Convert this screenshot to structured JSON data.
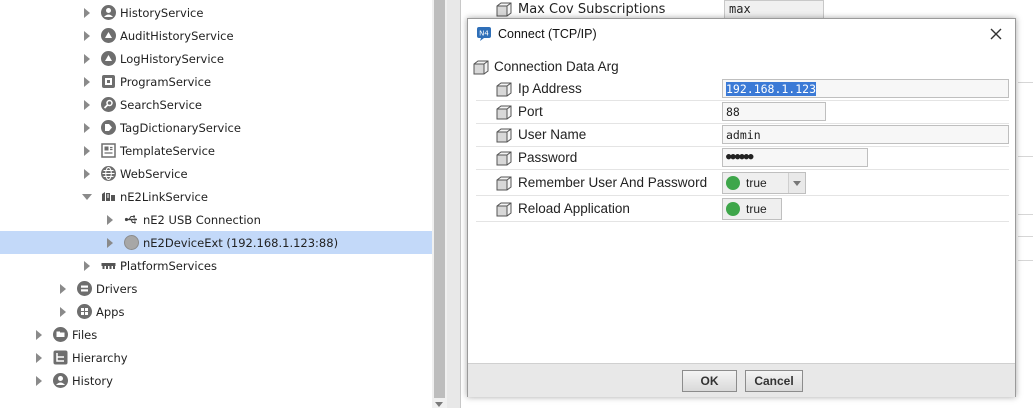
{
  "tree": {
    "items": [
      {
        "label": "HistoryService",
        "icon": "history-service-icon",
        "expanded": false
      },
      {
        "label": "AuditHistoryService",
        "icon": "audit-history-service-icon",
        "expanded": false
      },
      {
        "label": "LogHistoryService",
        "icon": "log-history-service-icon",
        "expanded": false
      },
      {
        "label": "ProgramService",
        "icon": "program-service-icon",
        "expanded": false
      },
      {
        "label": "SearchService",
        "icon": "search-service-icon",
        "expanded": false
      },
      {
        "label": "TagDictionaryService",
        "icon": "tag-dictionary-service-icon",
        "expanded": false
      },
      {
        "label": "TemplateService",
        "icon": "template-service-icon",
        "expanded": false
      },
      {
        "label": "WebService",
        "icon": "web-service-icon",
        "expanded": false
      },
      {
        "label": "nE2LinkService",
        "icon": "link-service-icon",
        "expanded": true
      },
      {
        "label": "nE2 USB Connection",
        "icon": "usb-icon",
        "expanded": false
      },
      {
        "label": "nE2DeviceExt (192.168.1.123:88)",
        "icon": "device-icon",
        "expanded": false,
        "selected": true
      },
      {
        "label": "PlatformServices",
        "icon": "platform-services-icon",
        "expanded": false
      },
      {
        "label": "Drivers",
        "icon": "drivers-icon",
        "expanded": false
      },
      {
        "label": "Apps",
        "icon": "apps-icon",
        "expanded": false
      },
      {
        "label": "Files",
        "icon": "files-icon",
        "expanded": false
      },
      {
        "label": "Hierarchy",
        "icon": "hierarchy-icon",
        "expanded": false
      },
      {
        "label": "History",
        "icon": "history-icon",
        "expanded": false
      }
    ]
  },
  "background_sheet": {
    "row_label": "Max Cov Subscriptions",
    "row_value": "max"
  },
  "dialog": {
    "title": "Connect (TCP/IP)",
    "section_label": "Connection Data Arg",
    "fields": {
      "ip_address": {
        "label": "Ip Address",
        "value": "192.168.1.123"
      },
      "port": {
        "label": "Port",
        "value": "88"
      },
      "user_name": {
        "label": "User Name",
        "value": "admin"
      },
      "password": {
        "label": "Password",
        "value": "●●●●●●"
      },
      "remember": {
        "label": "Remember User And Password",
        "value": "true"
      },
      "reload": {
        "label": "Reload Application",
        "value": "true"
      }
    },
    "ok_label": "OK",
    "cancel_label": "Cancel"
  },
  "colors": {
    "selection": "#c3d9f9",
    "true_indicator": "#3ea64a",
    "text_highlight": "#3b7ad6"
  }
}
